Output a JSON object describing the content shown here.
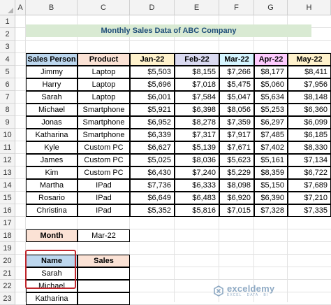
{
  "columns": [
    "A",
    "B",
    "C",
    "D",
    "E",
    "F",
    "G",
    "H"
  ],
  "rows": [
    "1",
    "2",
    "3",
    "4",
    "5",
    "6",
    "7",
    "8",
    "9",
    "10",
    "11",
    "12",
    "13",
    "14",
    "15",
    "16",
    "17",
    "18",
    "19",
    "20",
    "21",
    "22",
    "23"
  ],
  "title": "Monthly Sales Data of ABC Company",
  "table": {
    "headers": [
      "Sales Person",
      "Product",
      "Jan-22",
      "Feb-22",
      "Mar-22",
      "Apr-22",
      "May-22"
    ],
    "header_colors": [
      "#bdd7ee",
      "#fbe2d5",
      "#fff2cc",
      "#d9d9f0",
      "#d5f5ff",
      "#ffccff",
      "#fff2cc"
    ],
    "rows": [
      [
        "Jimmy",
        "Laptop",
        "$5,503",
        "$8,155",
        "$7,266",
        "$8,177",
        "$8,411"
      ],
      [
        "Harry",
        "Laptop",
        "$5,696",
        "$7,018",
        "$5,475",
        "$5,060",
        "$7,956"
      ],
      [
        "Sarah",
        "Laptop",
        "$6,001",
        "$7,584",
        "$5,047",
        "$5,634",
        "$8,148"
      ],
      [
        "Michael",
        "Smartphone",
        "$5,921",
        "$6,398",
        "$8,056",
        "$5,253",
        "$6,360"
      ],
      [
        "Jonas",
        "Smartphone",
        "$6,952",
        "$8,278",
        "$7,359",
        "$6,297",
        "$6,099"
      ],
      [
        "Katharina",
        "Smartphone",
        "$6,339",
        "$7,317",
        "$7,917",
        "$7,485",
        "$6,185"
      ],
      [
        "Kyle",
        "Custom PC",
        "$6,627",
        "$5,139",
        "$7,671",
        "$7,402",
        "$8,330"
      ],
      [
        "James",
        "Custom PC",
        "$5,025",
        "$8,036",
        "$5,623",
        "$5,161",
        "$7,134"
      ],
      [
        "Kim",
        "Custom PC",
        "$6,430",
        "$7,240",
        "$5,229",
        "$8,359",
        "$6,722"
      ],
      [
        "Martha",
        "IPad",
        "$7,736",
        "$6,333",
        "$8,098",
        "$5,150",
        "$7,689"
      ],
      [
        "Rosario",
        "IPad",
        "$6,649",
        "$6,483",
        "$6,920",
        "$6,390",
        "$7,210"
      ],
      [
        "Christina",
        "IPad",
        "$5,352",
        "$5,816",
        "$7,015",
        "$7,328",
        "$7,335"
      ]
    ]
  },
  "month": {
    "label": "Month",
    "value": "Mar-22",
    "label_color": "#fbe2d5"
  },
  "result": {
    "headers": [
      "Name",
      "Sales"
    ],
    "header_colors": [
      "#bdd7ee",
      "#fbe2d5"
    ],
    "names": [
      "Sarah",
      "Michael",
      "Katharina"
    ],
    "sales": [
      "",
      "",
      ""
    ]
  },
  "watermark": {
    "name": "exceldemy",
    "tagline": "EXCEL · DATA · BI"
  }
}
